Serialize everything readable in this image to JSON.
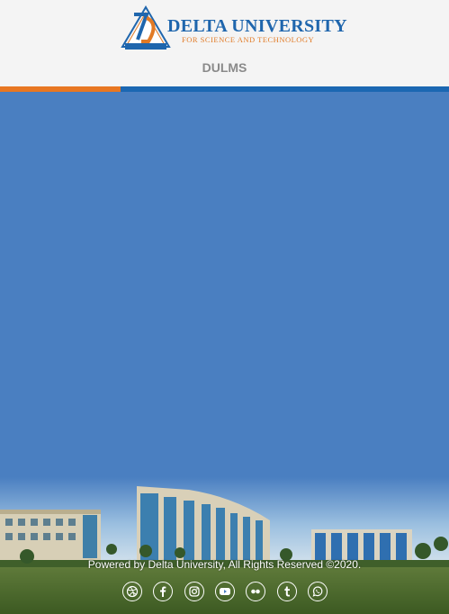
{
  "header": {
    "logo": {
      "name": "DELTA UNIVERSITY",
      "tagline": "FOR SCIENCE AND TECHNOLOGY",
      "mark_caption": "DELTA UNIVERSITY"
    },
    "app_title": "DULMS"
  },
  "colors": {
    "brand_blue": "#1f66ad",
    "brand_orange": "#e87722",
    "page_background": "#4a7fc1",
    "title_gray": "#8a8a8a"
  },
  "footer": {
    "copyright": "Powered by Delta University, All Rights Reserved ©2020.",
    "social_icons": [
      "dribbble-icon",
      "facebook-icon",
      "instagram-icon",
      "youtube-icon",
      "flickr-icon",
      "tumblr-icon",
      "whatsapp-icon"
    ]
  }
}
